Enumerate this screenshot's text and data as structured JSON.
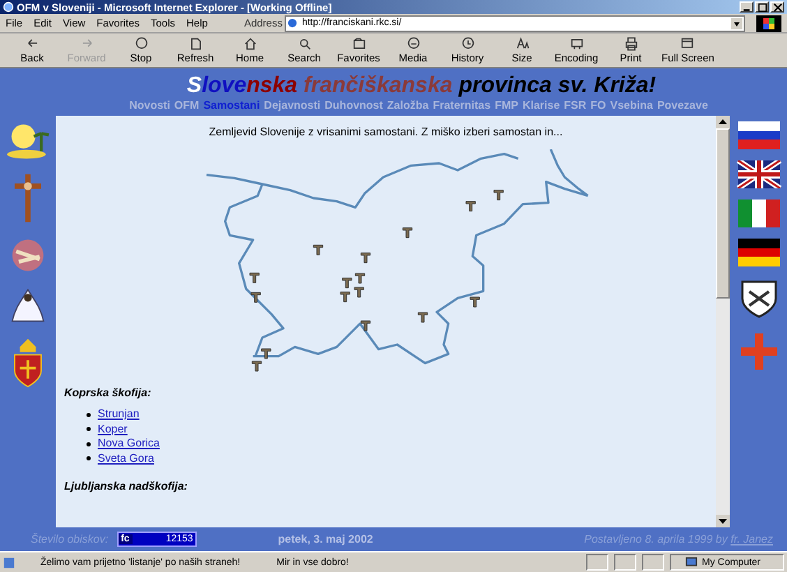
{
  "window": {
    "title": "OFM v Sloveniji - Microsoft Internet Explorer - [Working Offline]"
  },
  "menu": [
    "File",
    "Edit",
    "View",
    "Favorites",
    "Tools",
    "Help"
  ],
  "address": {
    "label": "Address",
    "value": "http://franciskani.rkc.si/"
  },
  "toolbar": [
    {
      "label": "Back",
      "kind": "back",
      "disabled": false
    },
    {
      "label": "Forward",
      "kind": "forward",
      "disabled": true
    },
    {
      "label": "Stop",
      "kind": "stop",
      "disabled": false
    },
    {
      "label": "Refresh",
      "kind": "refresh",
      "disabled": false
    },
    {
      "label": "Home",
      "kind": "home",
      "disabled": false
    },
    {
      "label": "Search",
      "kind": "search",
      "disabled": false
    },
    {
      "label": "Favorites",
      "kind": "favorites",
      "disabled": false
    },
    {
      "label": "Media",
      "kind": "media",
      "disabled": false
    },
    {
      "label": "History",
      "kind": "history",
      "disabled": false
    },
    {
      "label": "Size",
      "kind": "size",
      "disabled": false
    },
    {
      "label": "Encoding",
      "kind": "encoding",
      "disabled": false
    },
    {
      "label": "Print",
      "kind": "print",
      "disabled": false
    },
    {
      "label": "Full Screen",
      "kind": "fullscreen",
      "disabled": false
    }
  ],
  "page": {
    "title": [
      {
        "text": "S",
        "color": "#ffffff"
      },
      {
        "text": "love",
        "color": "#1010c0"
      },
      {
        "text": "nska ",
        "color": "#8c0000"
      },
      {
        "text": "frančiškanska ",
        "color": "#8a3a3a"
      },
      {
        "text": "provinca sv. Križa!",
        "color": "#000000"
      }
    ],
    "nav": [
      {
        "label": "Novosti",
        "selected": false
      },
      {
        "label": "OFM",
        "selected": false
      },
      {
        "label": "Samostani",
        "selected": true
      },
      {
        "label": "Dejavnosti",
        "selected": false
      },
      {
        "label": "Duhovnost",
        "selected": false
      },
      {
        "label": "Založba",
        "selected": false
      },
      {
        "label": "Fraternitas",
        "selected": false
      },
      {
        "label": "FMP",
        "selected": false
      },
      {
        "label": "Klarise",
        "selected": false
      },
      {
        "label": "FSR",
        "selected": false
      },
      {
        "label": "FO",
        "selected": false
      },
      {
        "label": "Vsebina",
        "selected": false
      },
      {
        "label": "Povezave",
        "selected": false
      }
    ],
    "intro": "Zemljevid Slovenije z vrisanimi samostani. Z miško izberi samostan in...",
    "dioceses": [
      {
        "name": "Koprska škofija:",
        "links": [
          "Strunjan",
          "Koper",
          "Nova Gorica",
          "Sveta Gora"
        ]
      },
      {
        "name": "Ljubljanska nadškofija:"
      }
    ],
    "footer": {
      "visits_label": "Število obiskov:",
      "counter_logo": "fc",
      "counter": "12153",
      "date": "petek, 3. maj 2002",
      "posted": "Postavljeno 8. aprila 1999 by",
      "author": "fr. Janez"
    }
  },
  "status_bar": {
    "message": "Želimo vam prijetno 'listanje' po naših straneh!",
    "message_2": "Mir in vse dobro!",
    "zone": "My Computer"
  }
}
